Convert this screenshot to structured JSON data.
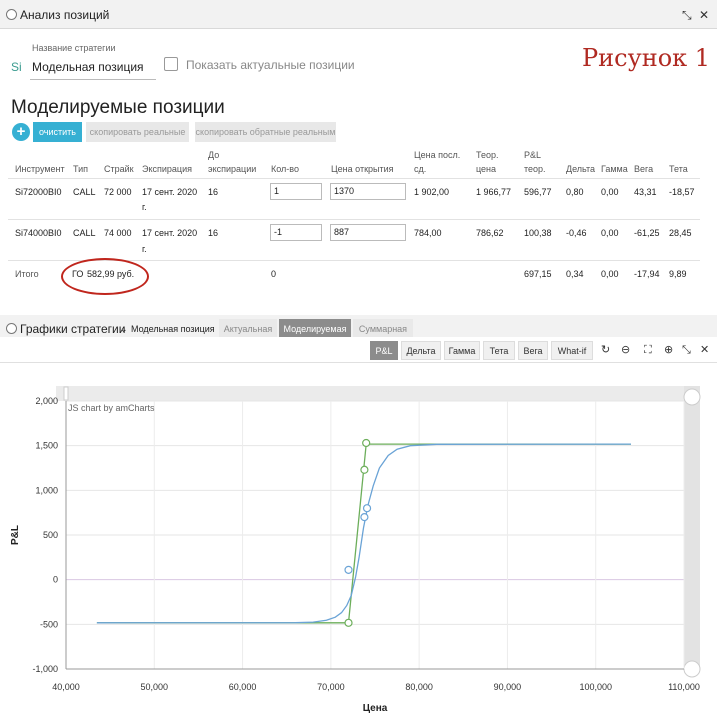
{
  "top_panel": {
    "title": "Анализ позиций",
    "strategy_label": "Название стратегии",
    "instrument_code": "Si",
    "strategy_name": "Модельная позиция",
    "show_actual_label": "Показать актуальные позиции",
    "figure_label": "Рисунок 1",
    "section_title": "Моделируемые позиции",
    "buttons": {
      "add": "+",
      "clear": "очистить",
      "copy_real": "скопировать реальные",
      "copy_reverse": "скопировать обратные реальным"
    }
  },
  "table": {
    "headers": {
      "instrument": "Инструмент",
      "type": "Тип",
      "strike": "Страйк",
      "expiration": "Экспирация",
      "days_1": "До",
      "days_2": "экспирации",
      "qty": "Кол-во",
      "open_price": "Цена открытия",
      "last_price_1": "Цена посл.",
      "last_price_2": "сд.",
      "theor_price_1": "Теор.",
      "theor_price_2": "цена",
      "pl_1": "P&L",
      "pl_2": "теор.",
      "delta": "Дельта",
      "gamma": "Гамма",
      "vega": "Вега",
      "theta": "Тета"
    },
    "rows": [
      {
        "instrument": "Si72000BI0",
        "type": "CALL",
        "strike": "72 000",
        "expiration_1": "17 сент. 2020",
        "expiration_2": "г.",
        "days": "16",
        "qty": "1",
        "open_price": "1370",
        "last_price": "1 902,00",
        "theor_price": "1 966,77",
        "pl": "596,77",
        "delta": "0,80",
        "gamma": "0,00",
        "vega": "43,31",
        "theta": "-18,57"
      },
      {
        "instrument": "Si74000BI0",
        "type": "CALL",
        "strike": "74 000",
        "expiration_1": "17 сент. 2020",
        "expiration_2": "г.",
        "days": "16",
        "qty": "-1",
        "open_price": "887",
        "last_price": "784,00",
        "theor_price": "786,62",
        "pl": "100,38",
        "delta": "-0,46",
        "gamma": "0,00",
        "vega": "-61,25",
        "theta": "28,45"
      }
    ],
    "total": {
      "label": "Итого",
      "go_label": "ГО",
      "go_value": "582,99",
      "go_unit": "руб.",
      "qty": "0",
      "pl": "697,15",
      "delta": "0,34",
      "gamma": "0,00",
      "vega": "-17,94",
      "theta": "9,89"
    }
  },
  "chart_panel": {
    "title": "Графики стратегии",
    "dropdown_label": "Модельная позиция",
    "tabs": [
      "Актуальная",
      "Моделируемая",
      "Суммарная"
    ],
    "active_tab": "Моделируемая",
    "toolbar_tabs": [
      "P&L",
      "Дельта",
      "Гамма",
      "Тета",
      "Вега",
      "What-if"
    ],
    "active_toolbar_tab": "P&L",
    "icons": [
      "refresh-icon",
      "zoom-out-icon",
      "fullscreen-icon",
      "zoom-in-icon",
      "close-icon"
    ]
  },
  "colors": {
    "accent": "#36b0d3",
    "figure_red": "#b02a22",
    "line_blue": "#6aa3d6",
    "line_green": "#6cae5a"
  },
  "chart_data": {
    "type": "line",
    "watermark": "JS chart by amCharts",
    "xlabel": "Цена",
    "ylabel": "P&L",
    "xlim": [
      40000,
      110000
    ],
    "ylim": [
      -1000,
      2000
    ],
    "x_ticks": [
      "40,000",
      "50,000",
      "60,000",
      "70,000",
      "80,000",
      "90,000",
      "100,000",
      "110,000"
    ],
    "y_ticks": [
      "2,000",
      "1,500",
      "1,000",
      "500",
      "0",
      "-500",
      "-1,000"
    ],
    "grid": true,
    "series": [
      {
        "color": "#6cae5a",
        "x": [
          43500,
          72000,
          74000,
          104000
        ],
        "y": [
          -483,
          -483,
          1517,
          1517
        ]
      },
      {
        "color": "#6aa3d6",
        "x": [
          43500,
          66000,
          68000,
          69500,
          70500,
          71200,
          71800,
          72300,
          72800,
          73200,
          73700,
          74200,
          74800,
          75500,
          76500,
          77500,
          79000,
          82000,
          104000
        ],
        "y": [
          -483,
          -482,
          -475,
          -455,
          -420,
          -370,
          -290,
          -180,
          30,
          250,
          580,
          830,
          1050,
          1250,
          1390,
          1460,
          1500,
          1515,
          1517
        ]
      }
    ],
    "markers": [
      {
        "color": "#6cae5a",
        "x": 72000,
        "y": -483
      },
      {
        "color": "#6cae5a",
        "x": 73800,
        "y": 1230
      },
      {
        "color": "#6cae5a",
        "x": 74000,
        "y": 1530
      },
      {
        "color": "#6aa3d6",
        "x": 72000,
        "y": 110
      },
      {
        "color": "#6aa3d6",
        "x": 73800,
        "y": 700
      },
      {
        "color": "#6aa3d6",
        "x": 74100,
        "y": 800
      }
    ]
  }
}
